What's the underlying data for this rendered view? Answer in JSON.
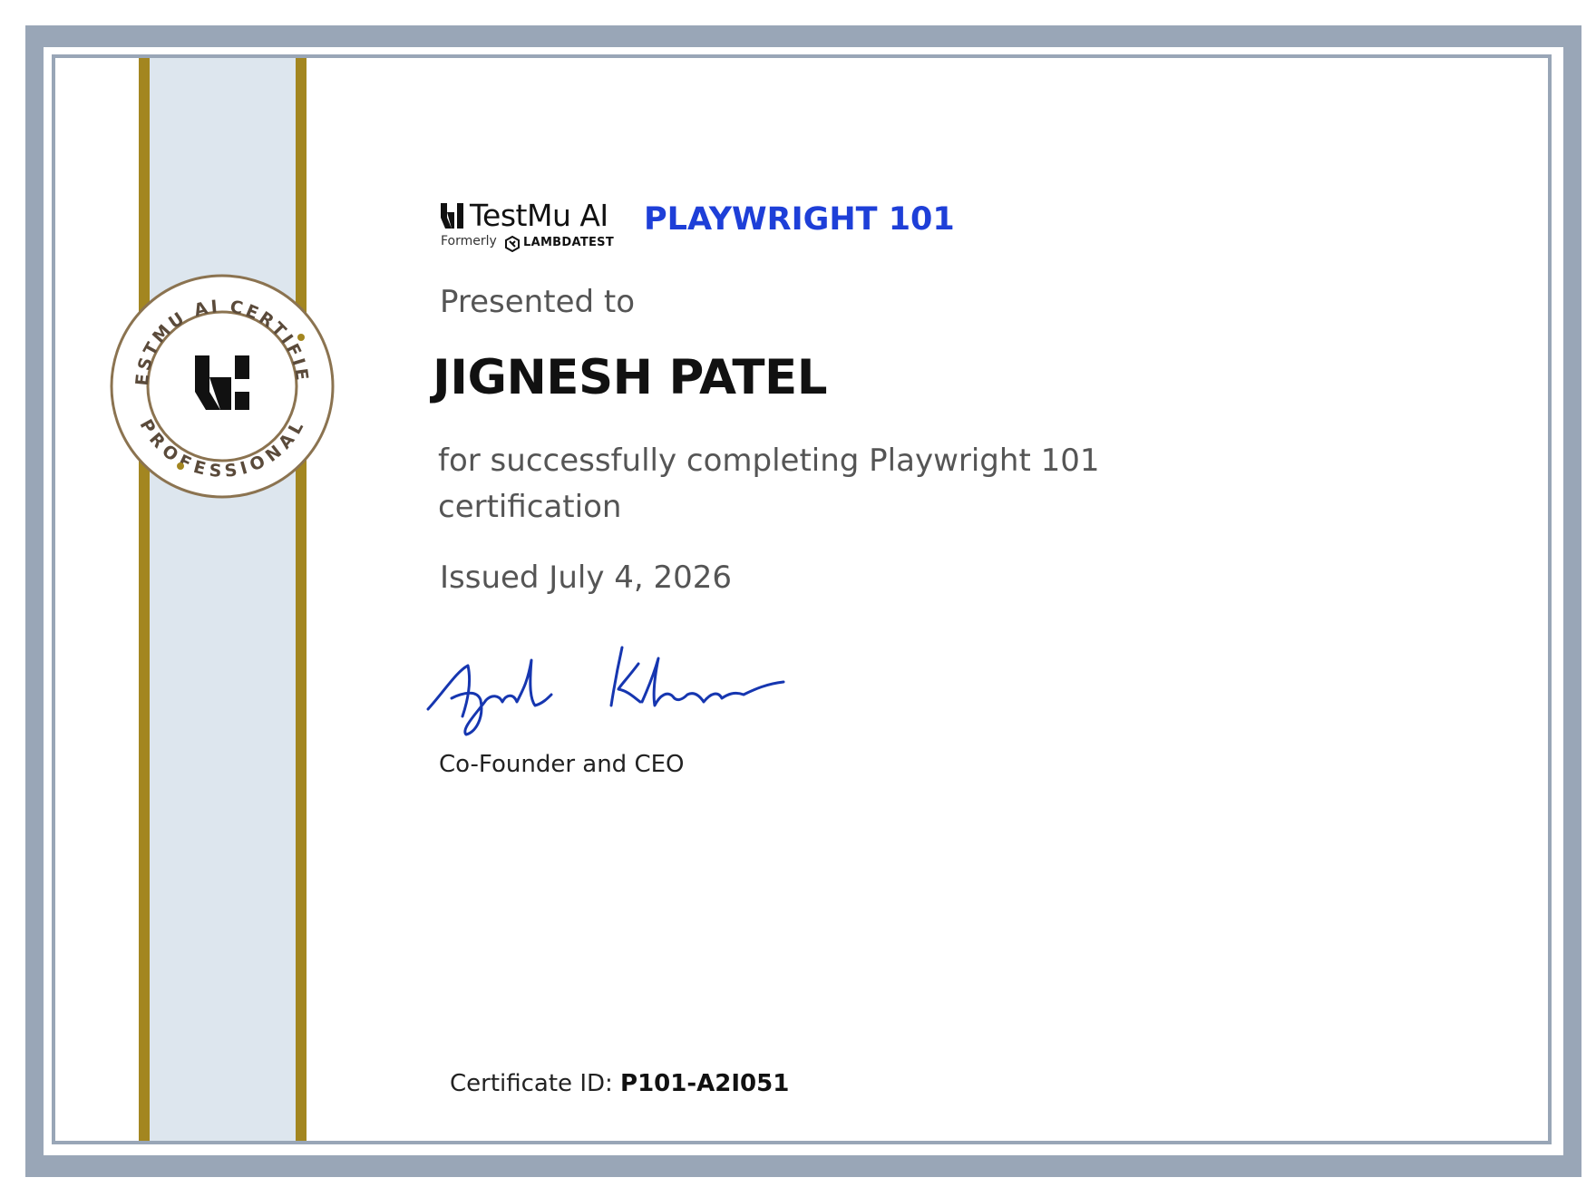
{
  "colors": {
    "frame": "#99a6b7",
    "ribbon": "#dde6ee",
    "gold": "#a38620",
    "course_blue": "#1e3fd8",
    "signature_blue": "#1636b0"
  },
  "brand": {
    "wordmark": "TestMu AI",
    "formerly_label": "Formerly",
    "former_brand": "LAMBDATEST"
  },
  "seal": {
    "text_top": "TESTMU AI CERTIFIED",
    "text_bottom": "PROFESSIONAL",
    "icon": "testmu-logo-icon"
  },
  "certificate": {
    "course": "PLAYWRIGHT 101",
    "presented_to": "Presented to",
    "recipient": "JIGNESH PATEL",
    "completion_line1": "for successfully completing Playwright 101",
    "completion_line2": "certification",
    "issued": "Issued July 4, 2026",
    "signer_title": "Co-Founder and CEO",
    "id_label": "Certificate ID: ",
    "id_value": "P101-A2I051"
  }
}
